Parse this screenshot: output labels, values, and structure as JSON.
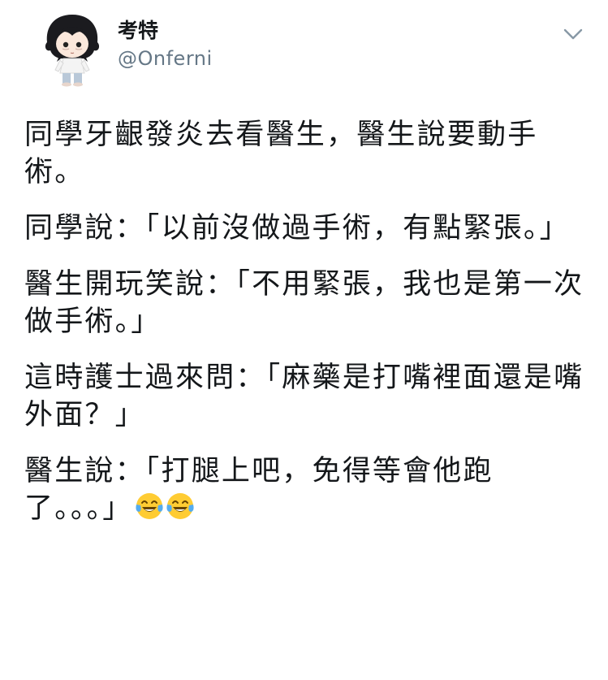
{
  "user": {
    "display_name": "考特",
    "handle": "@Onferni",
    "avatar_icon": "chibi-character-avatar-icon"
  },
  "menu": {
    "icon": "chevron-down-icon"
  },
  "tweet": {
    "paragraphs": [
      "同學牙齦發炎去看醫生，醫生說要動手術。",
      "同學說：「以前沒做過手術，有點緊張。」",
      "醫生開玩笑說：「不用緊張，我也是第一次做手術。」",
      "這時護士過來問：「麻藥是打嘴裡面還是嘴外面？」",
      "醫生說：「打腿上吧，免得等會他跑了。。。」"
    ],
    "trailing_emoji": [
      "face-with-tears-of-joy-icon",
      "face-with-tears-of-joy-icon"
    ]
  },
  "colors": {
    "text": "#14171a",
    "secondary": "#657786",
    "emoji_face": "#ffcc33",
    "emoji_tear": "#55acee"
  }
}
